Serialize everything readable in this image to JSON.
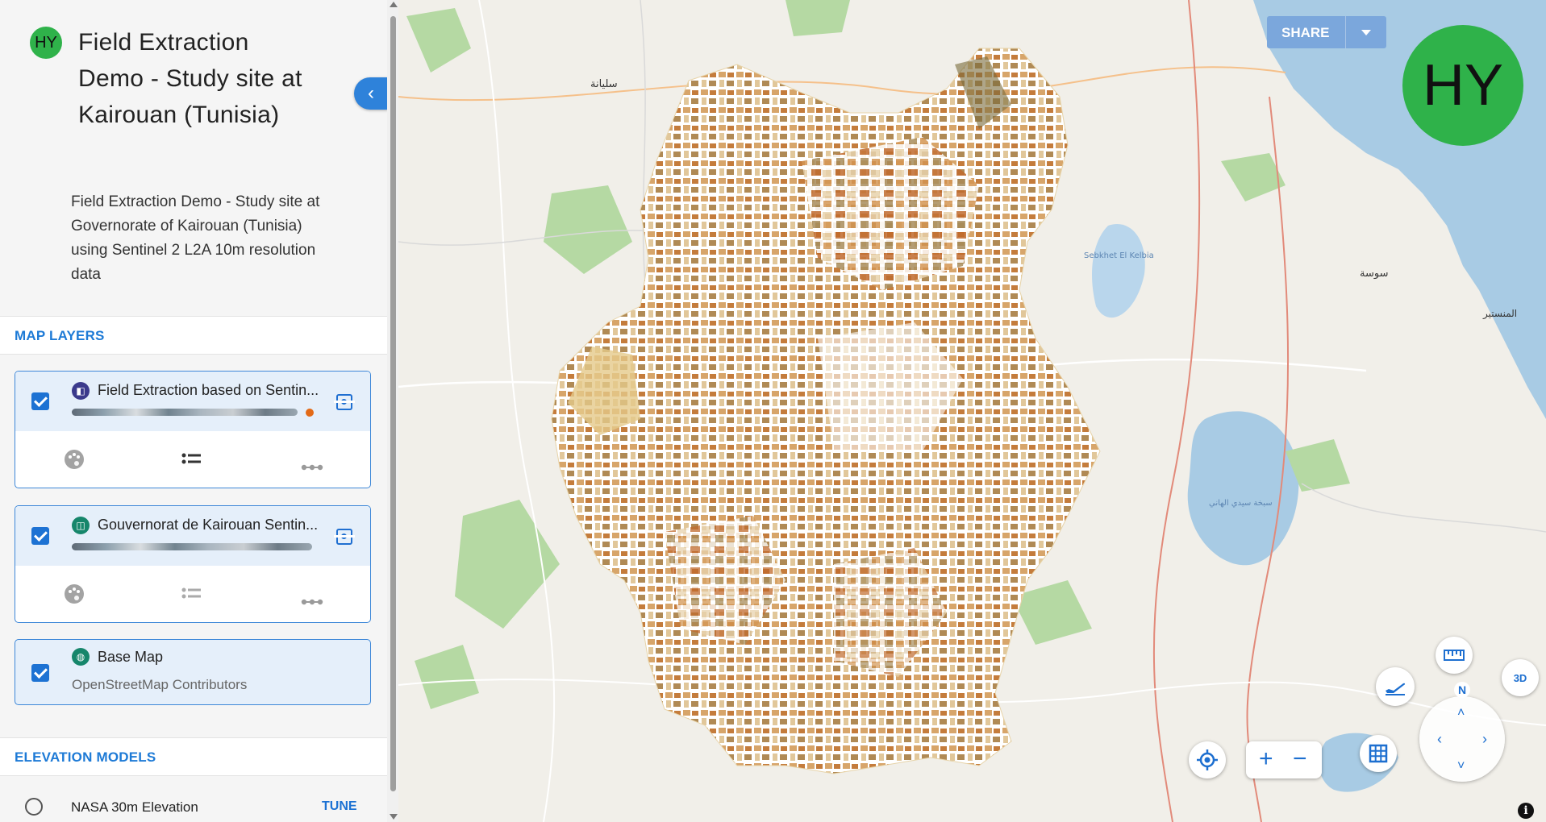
{
  "project": {
    "avatar_initials": "HY",
    "title": "Field Extraction Demo - Study site at Kairouan (Tunisia)",
    "description": "Field Extraction Demo - Study site at Governorate of Kairouan (Tunisia) using Sentinel 2 L2A 10m resolution data"
  },
  "sections": {
    "map_layers": "MAP LAYERS",
    "elevation_models": "ELEVATION MODELS"
  },
  "layers": [
    {
      "name": "Field Extraction based on Sentin...",
      "icon": "layer-stack-icon",
      "checked": true
    },
    {
      "name": "Gouvernorat de Kairouan Sentin...",
      "icon": "imagery-icon",
      "checked": true
    },
    {
      "name": "Base Map",
      "subtitle": "OpenStreetMap Contributors",
      "icon": "globe-icon",
      "checked": true
    }
  ],
  "elevation": {
    "name": "NASA 30m Elevation",
    "action": "TUNE",
    "selected": false
  },
  "map": {
    "share_label": "SHARE",
    "user_initials": "HY",
    "zoom_in": "+",
    "zoom_out": "−",
    "north_label": "N",
    "mode_3d": "3D",
    "info": "i",
    "places": {
      "sousse": "سوسة",
      "siliana": "سليانة",
      "sebkhet": "Sebkhet El Kelbia",
      "monastir": "المنستير",
      "kairouan_sebkha": "سبخة سيدي الهاني"
    }
  },
  "colors": {
    "accent": "#1d72d3",
    "avatar": "#2fb24a",
    "field_brown": "#c07a3a",
    "sea": "#a8cbe4"
  }
}
